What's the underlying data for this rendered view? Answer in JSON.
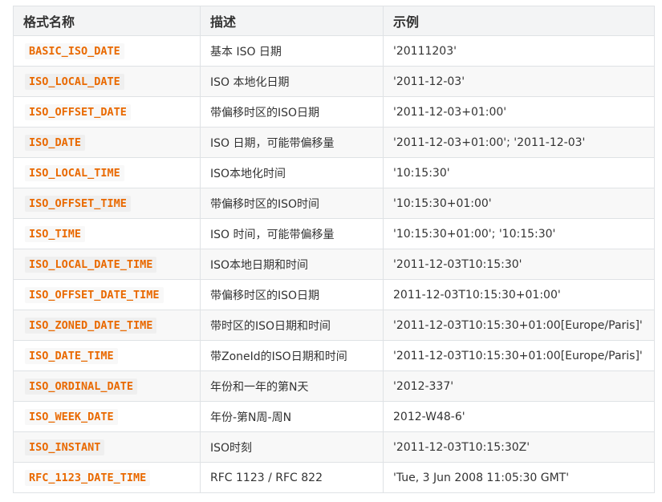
{
  "table": {
    "headers": [
      "格式名称",
      "描述",
      "示例"
    ],
    "rows": [
      {
        "format": "BASIC_ISO_DATE",
        "description": "基本 ISO 日期",
        "example": "'20111203'"
      },
      {
        "format": "ISO_LOCAL_DATE",
        "description": "ISO 本地化日期",
        "example": "'2011-12-03'"
      },
      {
        "format": "ISO_OFFSET_DATE",
        "description": "带偏移时区的ISO日期",
        "example": "'2011-12-03+01:00'"
      },
      {
        "format": "ISO_DATE",
        "description": "ISO 日期，可能带偏移量",
        "example": "'2011-12-03+01:00'; '2011-12-03'"
      },
      {
        "format": "ISO_LOCAL_TIME",
        "description": "ISO本地化时间",
        "example": "'10:15:30'"
      },
      {
        "format": "ISO_OFFSET_TIME",
        "description": "带偏移时区的ISO时间",
        "example": "'10:15:30+01:00'"
      },
      {
        "format": "ISO_TIME",
        "description": "ISO 时间，可能带偏移量",
        "example": "'10:15:30+01:00'; '10:15:30'"
      },
      {
        "format": "ISO_LOCAL_DATE_TIME",
        "description": "ISO本地日期和时间",
        "example": "'2011-12-03T10:15:30'"
      },
      {
        "format": "ISO_OFFSET_DATE_TIME",
        "description": "带偏移时区的ISO日期",
        "example": "2011-12-03T10:15:30+01:00'"
      },
      {
        "format": "ISO_ZONED_DATE_TIME",
        "description": "带时区的ISO日期和时间",
        "example": "'2011-12-03T10:15:30+01:00[Europe/Paris]'"
      },
      {
        "format": "ISO_DATE_TIME",
        "description": "带ZoneId的ISO日期和时间",
        "example": "'2011-12-03T10:15:30+01:00[Europe/Paris]'"
      },
      {
        "format": "ISO_ORDINAL_DATE",
        "description": "年份和一年的第N天",
        "example": "'2012-337'"
      },
      {
        "format": "ISO_WEEK_DATE",
        "description": "年份-第N周-周N",
        "example": "2012-W48-6'"
      },
      {
        "format": "ISO_INSTANT",
        "description": "ISO时刻",
        "example": "'2011-12-03T10:15:30Z'"
      },
      {
        "format": "RFC_1123_DATE_TIME",
        "description": "RFC 1123 / RFC 822",
        "example": "'Tue, 3 Jun 2008 11:05:30 GMT'"
      }
    ]
  },
  "colors": {
    "code_text": "#e96900",
    "header_bg": "#f3f4f5",
    "border": "#dfe2e5"
  }
}
